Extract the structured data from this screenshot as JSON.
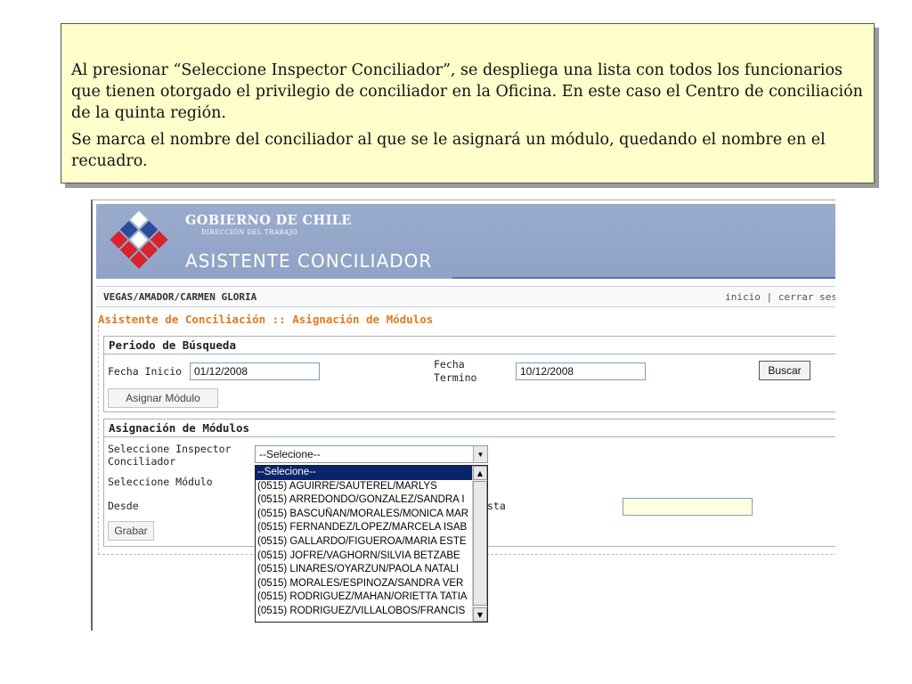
{
  "note": {
    "paragraph1": "Al presionar “Seleccione Inspector Conciliador”, se despliega una lista con todos los funcionarios que tienen otorgado el privilegio de conciliador en la Oficina. En este caso el Centro de conciliación de la quinta región.",
    "paragraph2": "Se marca el nombre del conciliador al que se le asignará un módulo, quedando el nombre en el recuadro."
  },
  "header": {
    "brand_line1": "GOBIERNO DE CHILE",
    "brand_line2": "DIRECCIÓN DEL TRABAJO",
    "app_name": "ASISTENTE CONCILIADOR",
    "colors": {
      "banner": "#95a9cb",
      "flag_red": "#d8242c",
      "flag_blue": "#2a4d9a"
    }
  },
  "userbar": {
    "user": "VEGAS/AMADOR/CARMEN GLORIA",
    "link_inicio": "inicio",
    "separator": "|",
    "link_cerrar": "cerrar ses"
  },
  "page_title": "Asistente de Conciliación :: Asignación de Módulos",
  "periodo": {
    "title": "Periodo de Búsqueda",
    "fecha_inicio_label": "Fecha Inicio",
    "fecha_inicio_value": "01/12/2008",
    "fecha_termino_label_1": "Fecha",
    "fecha_termino_label_2": "Termino",
    "fecha_termino_value": "10/12/2008",
    "buscar_button": "Buscar",
    "asignar_button": "Asignar Módulo"
  },
  "asignacion": {
    "title": "Asignación de Módulos",
    "inspector_label_1": "Seleccione Inspector",
    "inspector_label_2": "Conciliador",
    "inspector_selected": "--Selecione--",
    "modulo_label": "Seleccione Módulo",
    "desde_label": "Desde",
    "hasta_label": "sta",
    "grabar_button": "Grabar",
    "options": [
      "--Selecione--",
      "(0515) AGUIRRE/SAUTEREL/MARLYS",
      "(0515) ARREDONDO/GONZALEZ/SANDRA I",
      "(0515) BASCUÑAN/MORALES/MONICA MAR",
      "(0515) FERNANDEZ/LOPEZ/MARCELA ISAB",
      "(0515) GALLARDO/FIGUEROA/MARIA ESTE",
      "(0515) JOFRE/VAGHORN/SILVIA BETZABE",
      "(0515) LINARES/OYARZUN/PAOLA NATALI",
      "(0515) MORALES/ESPINOZA/SANDRA VER",
      "(0515) RODRIGUEZ/MAHAN/ORIETTA TATIA",
      "(0515) RODRIGUEZ/VILLALOBOS/FRANCIS"
    ],
    "highlighted_option_index": 0
  }
}
